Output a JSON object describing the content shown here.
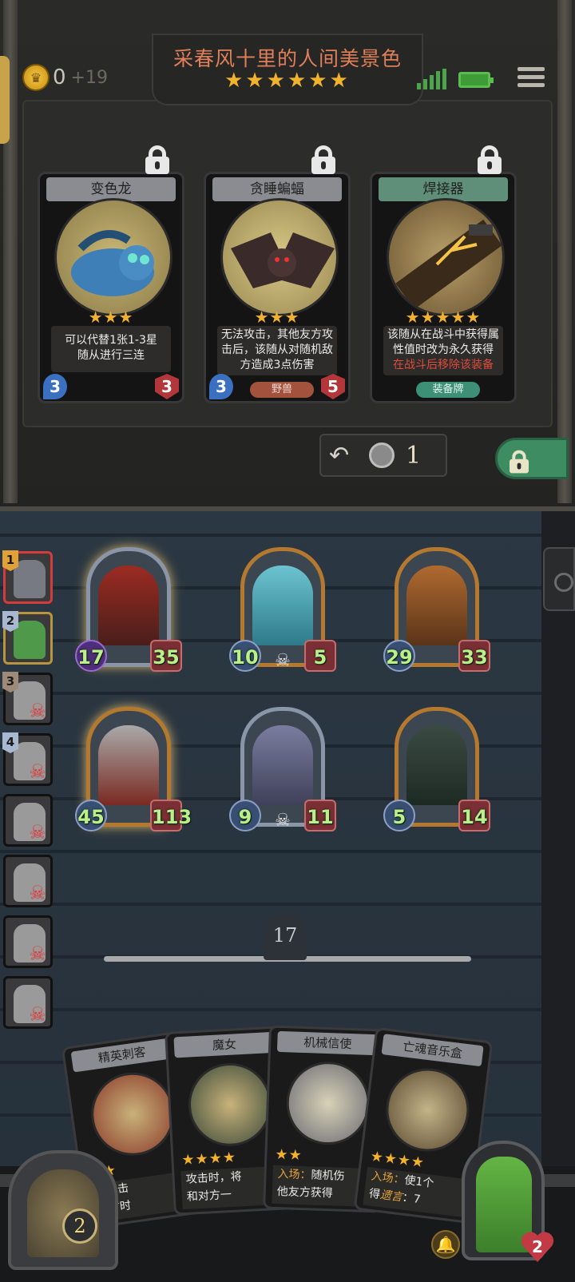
{
  "header": {
    "title": "采春风十里的人间美景色",
    "tier_stars": "★★★★★★",
    "gold": "0",
    "gold_income": "+19"
  },
  "shop_cards": [
    {
      "name": "变色龙",
      "stars": "★★★",
      "desc_line1": "可以代替1张1-3星",
      "desc_line2": "随从进行三连",
      "attack": "3",
      "health": "3",
      "tribe": ""
    },
    {
      "name": "贪睡蝙蝠",
      "stars": "★★★",
      "desc_line1": "无法攻击，其他友方攻",
      "desc_line2": "击后，该随从对随机敌",
      "desc_line3": "方造成3点伤害",
      "attack": "3",
      "health": "5",
      "tribe": "野兽"
    },
    {
      "name": "焊接器",
      "stars": "★★★★★",
      "desc_line1": "该随从在战斗中获得属",
      "desc_line2": "性值时改为永久获得",
      "desc_line3": "在战斗后移除该装备",
      "tribe": "装备牌"
    }
  ],
  "refresh": {
    "icon": "refresh-icon",
    "cost": "1"
  },
  "players": [
    {
      "rank": "1"
    },
    {
      "rank": "2"
    },
    {
      "rank": "3"
    },
    {
      "rank": "4"
    },
    {
      "rank": ""
    },
    {
      "rank": ""
    },
    {
      "rank": ""
    },
    {
      "rank": ""
    }
  ],
  "board": [
    {
      "attack": "17",
      "health": "35"
    },
    {
      "attack": "10",
      "health": "5"
    },
    {
      "attack": "29",
      "health": "33"
    },
    {
      "attack": "45",
      "health": "113"
    },
    {
      "attack": "9",
      "health": "11"
    },
    {
      "attack": "5",
      "health": "14"
    }
  ],
  "turn": "17",
  "hand": [
    {
      "name": "精英刺客",
      "stars": "★★",
      "desc1": "，攻击",
      "desc2": "对方时"
    },
    {
      "name": "魔女",
      "stars": "★★★★",
      "desc1": "攻击时，将",
      "desc2": "和对方一"
    },
    {
      "name": "机械信使",
      "stars": "★★",
      "desc_kw": "入场：",
      "desc1": "随机伤",
      "desc2": "他友方获得"
    },
    {
      "name": "亡魂音乐盒",
      "stars": "★★★★",
      "desc_kw": "入场：",
      "desc1": "使1个",
      "desc2_pre": "得",
      "desc2_kw": "遗言",
      "desc2_post": "：7"
    }
  ],
  "gate_count": "2",
  "hero_health": "2",
  "colors": {
    "gold_star": "#f2b22b",
    "title": "#e07f5a",
    "stat_green": "#b9f08a"
  }
}
